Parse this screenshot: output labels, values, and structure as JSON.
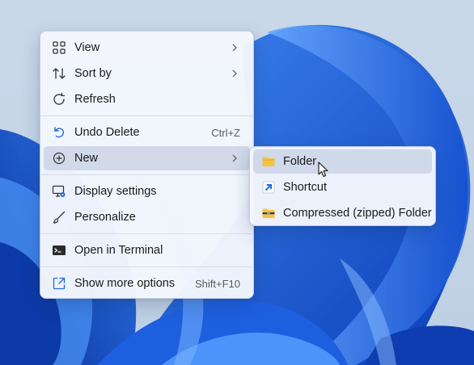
{
  "context_menu": {
    "items": [
      {
        "label": "View",
        "icon": "grid-icon",
        "has_submenu": true
      },
      {
        "label": "Sort by",
        "icon": "sort-arrows-icon",
        "has_submenu": true
      },
      {
        "label": "Refresh",
        "icon": "refresh-icon",
        "has_submenu": false
      },
      {
        "label": "Undo Delete",
        "icon": "undo-icon",
        "shortcut": "Ctrl+Z"
      },
      {
        "label": "New",
        "icon": "plus-circle-icon",
        "has_submenu": true,
        "highlighted": true
      },
      {
        "label": "Display settings",
        "icon": "display-settings-icon"
      },
      {
        "label": "Personalize",
        "icon": "paintbrush-icon"
      },
      {
        "label": "Open in Terminal",
        "icon": "terminal-icon"
      },
      {
        "label": "Show more options",
        "icon": "expand-icon",
        "shortcut": "Shift+F10"
      }
    ]
  },
  "submenu": {
    "items": [
      {
        "label": "Folder",
        "icon": "folder-icon",
        "highlighted": true
      },
      {
        "label": "Shortcut",
        "icon": "shortcut-arrow-icon"
      },
      {
        "label": "Compressed (zipped) Folder",
        "icon": "zip-folder-icon"
      }
    ]
  },
  "colors": {
    "accent": "#1f6fd6",
    "menu_background": "#f3f6fc",
    "highlight": "#cdd6e8",
    "folder": "#f4c443"
  }
}
